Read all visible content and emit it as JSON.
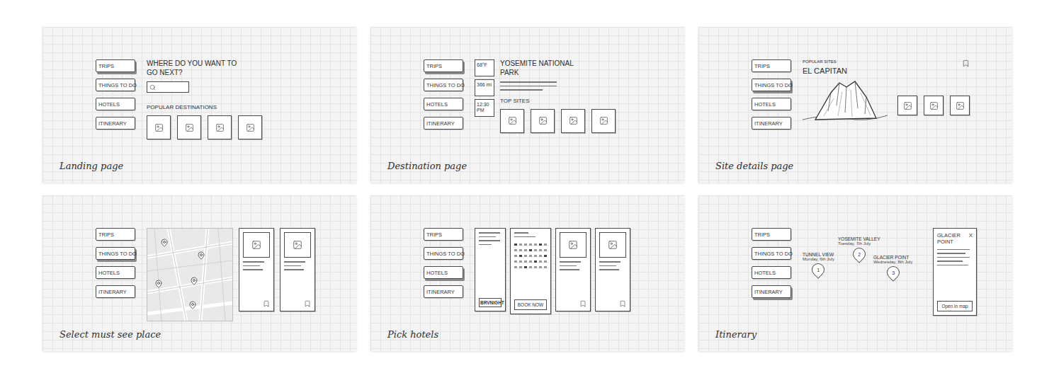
{
  "panels": [
    {
      "kind": "landing",
      "caption": "Landing page",
      "nav": [
        {
          "label": "TRIPS",
          "selected": true
        },
        {
          "label": "THINGS TO DO",
          "selected": false
        },
        {
          "label": "HOTELS",
          "selected": false
        },
        {
          "label": "ITINERARY",
          "selected": false
        }
      ],
      "heading": "WHERE DO YOU WANT TO GO NEXT?",
      "section": "POPULAR DESTINATIONS"
    },
    {
      "kind": "destination",
      "caption": "Destination page",
      "nav": [
        {
          "label": "TRIPS",
          "selected": true
        },
        {
          "label": "THINGS TO DO",
          "selected": false
        },
        {
          "label": "HOTELS",
          "selected": false
        },
        {
          "label": "ITINERARY",
          "selected": false
        }
      ],
      "stats": [
        "68°F",
        "366 mi",
        "12:30 PM"
      ],
      "title": "YOSEMITE NATIONAL PARK",
      "section": "TOP SITES"
    },
    {
      "kind": "site",
      "caption": "Site details page",
      "nav": [
        {
          "label": "TRIPS",
          "selected": false
        },
        {
          "label": "THINGS TO DO",
          "selected": true
        },
        {
          "label": "HOTELS",
          "selected": false
        },
        {
          "label": "ITINERARY",
          "selected": false
        }
      ],
      "subtitle": "POPULAR SITES",
      "title": "EL CAPITAN"
    },
    {
      "kind": "map",
      "caption": "Select must see place",
      "nav": [
        {
          "label": "TRIPS",
          "selected": false
        },
        {
          "label": "THINGS TO DO",
          "selected": true
        },
        {
          "label": "HOTELS",
          "selected": false
        },
        {
          "label": "ITINERARY",
          "selected": false
        }
      ]
    },
    {
      "kind": "hotels",
      "caption": "Pick hotels",
      "nav": [
        {
          "label": "TRIPS",
          "selected": false
        },
        {
          "label": "THINGS TO DO",
          "selected": false
        },
        {
          "label": "HOTELS",
          "selected": true
        },
        {
          "label": "ITINERARY",
          "selected": false
        }
      ],
      "hotel_name": "BRVNIGHT",
      "book_button": "BOOK NOW"
    },
    {
      "kind": "itinerary",
      "caption": "Itinerary",
      "nav": [
        {
          "label": "TRIPS",
          "selected": false
        },
        {
          "label": "THINGS TO DO",
          "selected": false
        },
        {
          "label": "HOTELS",
          "selected": false
        },
        {
          "label": "ITINERARY",
          "selected": true
        }
      ],
      "stops": [
        {
          "number": "1",
          "name": "TUNNEL VIEW",
          "date": "Monday, 6th July"
        },
        {
          "number": "2",
          "name": "YOSEMITE VALLEY",
          "date": "Tuesday, 7th July"
        },
        {
          "number": "3",
          "name": "GLACIER POINT",
          "date": "Wednesday, 8th July"
        }
      ],
      "detail": {
        "title": "GLACIER POINT",
        "close": "X",
        "button": "Open in map"
      }
    }
  ]
}
